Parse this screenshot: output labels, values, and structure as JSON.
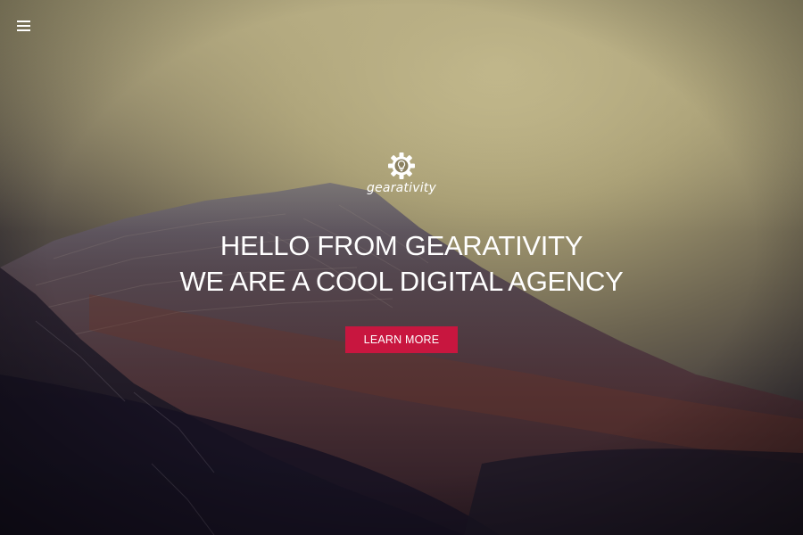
{
  "nav": {
    "menu_icon": "hamburger-menu-icon"
  },
  "brand": {
    "icon": "gear-lightbulb-icon",
    "name": "gearativity"
  },
  "hero": {
    "headline_line1": "HELLO FROM GEARATIVITY",
    "headline_line2": "WE ARE A COOL DIGITAL AGENCY",
    "cta_label": "LEARN MORE",
    "background": "misty-mountain-photo"
  },
  "colors": {
    "cta_background": "#c8163f",
    "text": "#ffffff",
    "sky": "#a69c74",
    "mountain_dark": "#2a1e28"
  }
}
